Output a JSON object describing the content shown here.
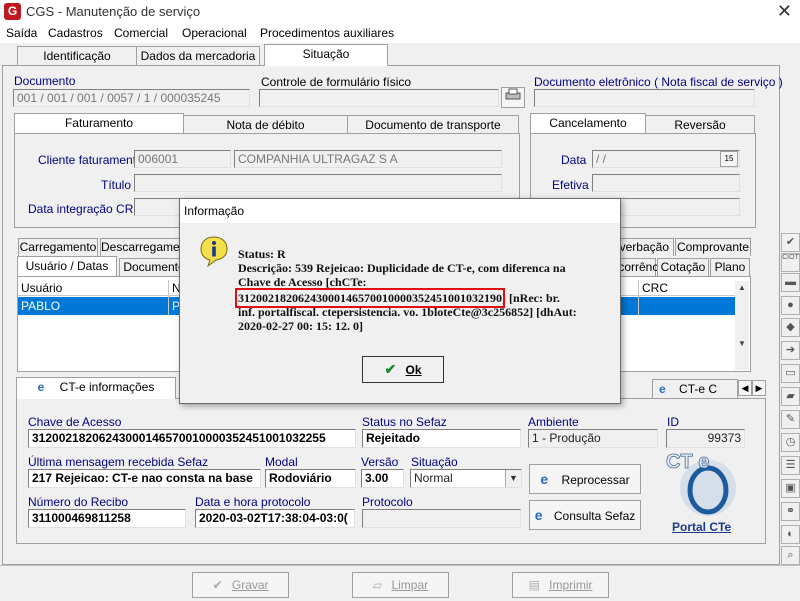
{
  "window": {
    "title": "CGS - Manutenção de serviço",
    "logo_letter": "G",
    "close_glyph": "✕"
  },
  "menu": [
    "Saída",
    "Cadastros",
    "Comercial",
    "Operacional",
    "Procedimentos auxiliares"
  ],
  "main_tabs": [
    "Identificação",
    "Dados da mercadoria",
    "Situação"
  ],
  "documento": {
    "documento_label": "Documento",
    "documento_value": "001 / 001 / 001 / 0057 / 1 / 000035245",
    "controle_label": "Controle de formulário físico",
    "doc_eletronico_label": "Documento eletrônico ( Nota fiscal de serviço )"
  },
  "fat_tabs": [
    "Faturamento",
    "Nota de débito",
    "Documento de transporte"
  ],
  "faturamento": {
    "cliente_label": "Cliente faturamento",
    "cliente_code": "006001",
    "cliente_name": "COMPANHIA ULTRAGAZ S A",
    "titulo_label": "Título",
    "data_integracao_label": "Data integração CRC"
  },
  "canc_tabs": [
    "Cancelamento",
    "Reversão"
  ],
  "cancelamento": {
    "data_label": "Data",
    "data_value": " /  /",
    "efetiva_label": "Efetiva",
    "cal_icon": "15"
  },
  "mid_tabs_row1": [
    "Carregamento",
    "Descarregamento",
    "Averbação",
    "Comprovante"
  ],
  "mid_tabs_row2": [
    "Usuário / Datas",
    "Documento",
    "Ocorrências",
    "Cotação",
    "Plano"
  ],
  "grid": {
    "col_usuario": "Usuário",
    "col_n": "N",
    "col_crc": "CRC",
    "row_usuario": "PABLO",
    "row_n": "P"
  },
  "cte_tabs": {
    "left": "CT-e informações",
    "right": "CT-e C"
  },
  "cte": {
    "chave_label": "Chave de Acesso",
    "chave_value": "31200218206243000146570010000352451001032255",
    "status_label": "Status no Sefaz",
    "status_value": "Rejeitado",
    "ambiente_label": "Ambiente",
    "ambiente_value": "1 - Produção",
    "id_label": "ID",
    "id_value": "99373",
    "ultima_label": "Última mensagem recebida Sefaz",
    "ultima_value": "217 Rejeicao: CT-e nao consta na base",
    "modal_label": "Modal",
    "modal_value": "Rodoviário",
    "versao_label": "Versão",
    "versao_value": "3.00",
    "situacao_label": "Situação",
    "situacao_value": "Normal",
    "recibo_label": "Número do Recibo",
    "recibo_value": "311000469811258",
    "datahora_label": "Data e hora protocolo",
    "datahora_value": "2020-03-02T17:38:04-03:0(",
    "protocolo_label": "Protocolo",
    "reprocessar_label": "Reprocessar",
    "consulta_label": "Consulta Sefaz",
    "portal_label": "Portal CTe",
    "portal_logo_text": "CT e"
  },
  "bottom": {
    "gravar": "Gravar",
    "limpar": "Limpar",
    "imprimir": "Imprimir"
  },
  "dialog": {
    "title": "Informação",
    "status_line": "Status: R",
    "desc_line1": "Descrição: 539 Rejeicao: Duplicidade de CT-e, com diferenca na",
    "desc_line2": "Chave de Acesso [chCTe:",
    "chave_highlight": "31200218206243000146570010000352451001032190",
    "desc_after": "] [nRec: br.",
    "desc_line4": "inf. portalfiscal. ctepersistencia. vo. 1bloteCte@3c256852] [dhAut:",
    "desc_line5": "2020-02-27 00: 15: 12. 0]",
    "ok_label": "Ok",
    "ok_check": "✔"
  },
  "colors": {
    "accent_blue": "#000080",
    "selection": "#0078d7",
    "highlight_red": "#e01010"
  }
}
